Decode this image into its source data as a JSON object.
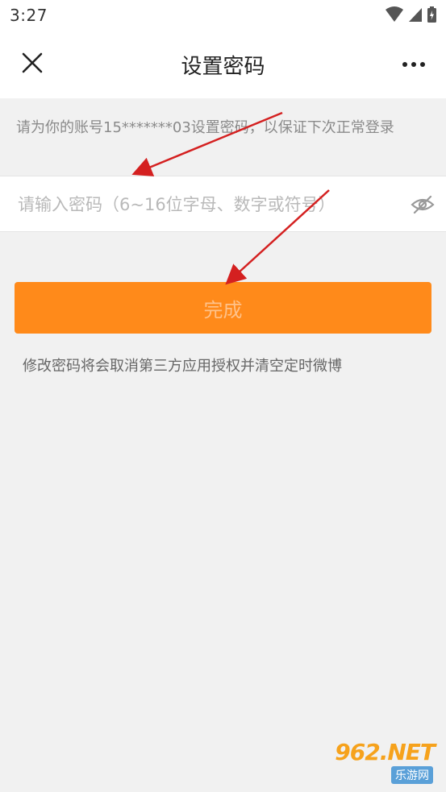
{
  "status_bar": {
    "time": "3:27"
  },
  "nav": {
    "title": "设置密码",
    "close_icon": "close-icon",
    "more_icon": "more-icon"
  },
  "hint": "请为你的账号15*******03设置密码，以保证下次正常登录",
  "password": {
    "value": "",
    "placeholder": "请输入密码（6~16位字母、数字或符号）",
    "toggle_icon": "eye-off-icon"
  },
  "done_label": "完成",
  "note": "修改密码将会取消第三方应用授权并清空定时微博",
  "watermark": {
    "logo": "962.NET",
    "sub": "乐游网"
  },
  "colors": {
    "accent": "#ff8a1a",
    "accent_text": "#ffc28a",
    "background": "#f1f1f1",
    "annotation_arrow": "#d42020"
  }
}
